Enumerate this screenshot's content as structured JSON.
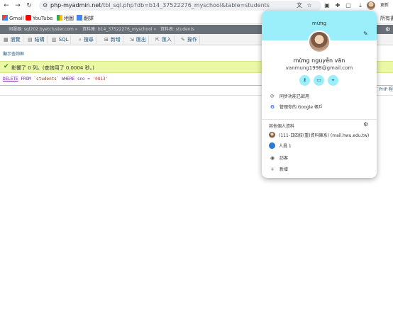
{
  "browser": {
    "url_domain": "php-myadmin.net",
    "url_path": "/tbl_sql.php?db=b14_37522276_myschool&table=students",
    "update_label": "更新",
    "overflow_label": "所有書",
    "bookmarks": [
      {
        "label": "Gmail",
        "icon": "gmail-icon"
      },
      {
        "label": "YouTube",
        "icon": "youtube-icon"
      },
      {
        "label": "地圖",
        "icon": "maps-icon"
      },
      {
        "label": "翻譯",
        "icon": "translate-icon"
      }
    ]
  },
  "pma": {
    "breadcrumb": [
      "伺服器: sql202.byetcluster.com »",
      "資料庫: b14_37522276_myschool »",
      "資料表: students"
    ],
    "tabs": [
      {
        "label": "瀏覽",
        "icon": "table-icon"
      },
      {
        "label": "結構",
        "icon": "structure-icon"
      },
      {
        "label": "SQL",
        "icon": "sql-icon"
      },
      {
        "label": "搜尋",
        "icon": "search-icon"
      },
      {
        "label": "新增",
        "icon": "insert-icon"
      },
      {
        "label": "匯出",
        "icon": "export-icon"
      },
      {
        "label": "匯入",
        "icon": "import-icon"
      },
      {
        "label": "操作",
        "icon": "wrench-icon"
      }
    ],
    "show_query": "顯示查詢框",
    "success_message": "影響了 0 列。(查詢用了 0.0004 秒。)",
    "sql": {
      "keyword": "DELETE",
      "from": "FROM",
      "table": "`students`",
      "where": "WHERE sno =",
      "value": "'0813'"
    },
    "php_link": "[ PHP 程式碼 ]"
  },
  "profile_popup": {
    "header_name": "mừng",
    "full_name": "mừng nguyễn văn",
    "email": "vanmung1998@gmail.com",
    "sync_text": "同步功能已啟用",
    "manage_account": "管理你的 Google 帳戶",
    "other_profiles_title": "其他個人資料",
    "other_profile_1": "(111-日四技(重)資料庫系) (mail.hwu.edu.tw)",
    "guest": "訪客",
    "guest_label": "人員 1",
    "add": "新增"
  }
}
